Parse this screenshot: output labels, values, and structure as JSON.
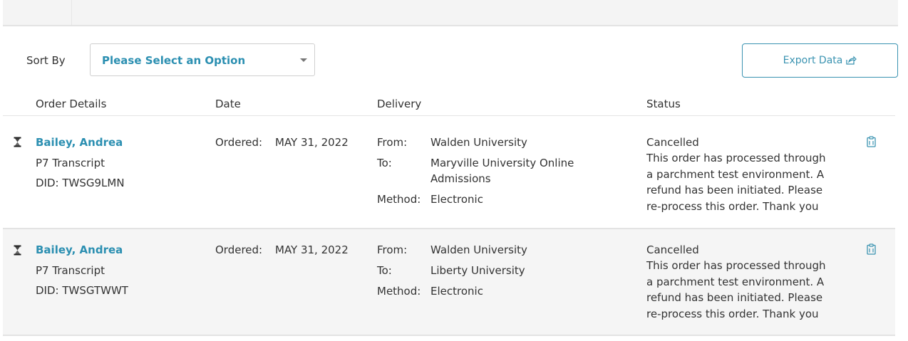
{
  "sort": {
    "label": "Sort By",
    "selected": "Please Select an Option"
  },
  "export": {
    "label": "Export Data",
    "icon": "export-share-icon"
  },
  "table": {
    "headers": [
      "Order Details",
      "Date",
      "Delivery",
      "Status"
    ],
    "rows": [
      {
        "status_icon": "hourglass-icon",
        "name": "Bailey, Andrea",
        "document": "P7 Transcript",
        "did": "DID: TWSG9LMN",
        "date_label": "Ordered:",
        "date_value": "MAY 31, 2022",
        "from_label": "From:",
        "from_value": "Walden University",
        "to_label": "To:",
        "to_value": "Maryville University Online Admissions",
        "method_label": "Method:",
        "method_value": "Electronic",
        "status": "Cancelled",
        "status_note": "This order has processed through a parchment test environment. A refund has been initiated. Please re-process this order. Thank you",
        "action_icon": "clipboard-icon"
      },
      {
        "status_icon": "hourglass-icon",
        "name": "Bailey, Andrea",
        "document": "P7 Transcript",
        "did": "DID: TWSGTWWT",
        "date_label": "Ordered:",
        "date_value": "MAY 31, 2022",
        "from_label": "From:",
        "from_value": "Walden University",
        "to_label": "To:",
        "to_value": "Liberty University",
        "method_label": "Method:",
        "method_value": "Electronic",
        "status": "Cancelled",
        "status_note": "This order has processed through a parchment test environment. A refund has been initiated. Please re-process this order. Thank you",
        "action_icon": "clipboard-icon"
      }
    ]
  },
  "colors": {
    "accent": "#2b8fb1",
    "border": "#e3e3e3",
    "row_alt": "#f5f5f5"
  }
}
